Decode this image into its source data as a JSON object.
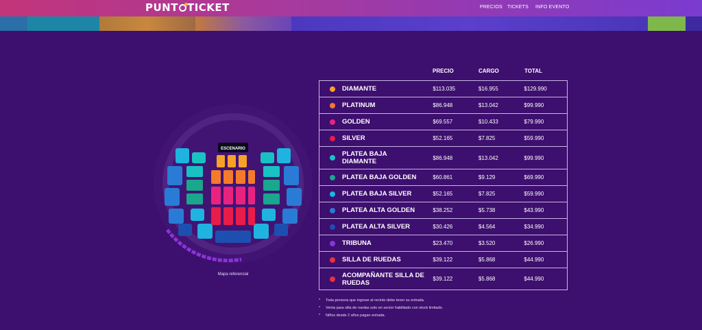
{
  "header": {
    "logo_left": "PUNT",
    "logo_right": "TICKET",
    "nav": [
      "PRECIOS",
      "TICKETS",
      "INFO EVENTO"
    ]
  },
  "map": {
    "stage_label": "ESCENARIO",
    "caption": "Mapa referencial"
  },
  "table": {
    "headers": {
      "precio": "PRECIO",
      "cargo": "CARGO",
      "total": "TOTAL"
    },
    "rows": [
      {
        "name": "DIAMANTE",
        "color": "#f6a22a",
        "precio": "$113.035",
        "cargo": "$16.955",
        "total": "$129.990"
      },
      {
        "name": "PLATINUM",
        "color": "#f47a2c",
        "precio": "$86.948",
        "cargo": "$13.042",
        "total": "$99.990"
      },
      {
        "name": "GOLDEN",
        "color": "#e8237f",
        "precio": "$69.557",
        "cargo": "$10.433",
        "total": "$79.990"
      },
      {
        "name": "SILVER",
        "color": "#e81c4a",
        "precio": "$52.165",
        "cargo": "$7.825",
        "total": "$59.990"
      },
      {
        "name": "PLATEA BAJA DIAMANTE",
        "color": "#19c2c2",
        "precio": "$86.948",
        "cargo": "$13.042",
        "total": "$99.990"
      },
      {
        "name": "PLATEA BAJA GOLDEN",
        "color": "#19a78d",
        "precio": "$60.861",
        "cargo": "$9.129",
        "total": "$69.990"
      },
      {
        "name": "PLATEA BAJA SILVER",
        "color": "#1fb3e0",
        "precio": "$52.165",
        "cargo": "$7.825",
        "total": "$59.990"
      },
      {
        "name": "PLATEA ALTA GOLDEN",
        "color": "#2a7bd6",
        "precio": "$38.252",
        "cargo": "$5.738",
        "total": "$43.990"
      },
      {
        "name": "PLATEA ALTA SILVER",
        "color": "#1d4fb0",
        "precio": "$30.426",
        "cargo": "$4.564",
        "total": "$34.990"
      },
      {
        "name": "TRIBUNA",
        "color": "#8a34d8",
        "precio": "$23.470",
        "cargo": "$3.520",
        "total": "$26.990"
      },
      {
        "name": "SILLA DE RUEDAS",
        "color": "#e8323a",
        "precio": "$39.122",
        "cargo": "$5.868",
        "total": "$44.990"
      },
      {
        "name": "ACOMPAÑANTE SILLA DE RUEDAS",
        "color": "#e8323a",
        "precio": "$39.122",
        "cargo": "$5.868",
        "total": "$44.990"
      }
    ]
  },
  "notes": [
    "Toda persona que ingrese al recinto debe tener su entrada.",
    "Venta para silla de ruedas solo en sector habilitado con stock limitado.",
    "Niños desde 2 años pagan entrada."
  ]
}
